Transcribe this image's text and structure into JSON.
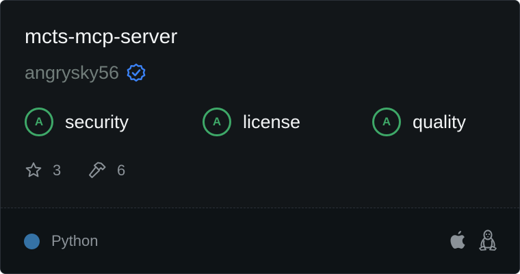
{
  "repo": {
    "name": "mcts-mcp-server",
    "author": "angrysky56",
    "verified": true
  },
  "grades": [
    {
      "letter": "A",
      "label": "security"
    },
    {
      "letter": "A",
      "label": "license"
    },
    {
      "letter": "A",
      "label": "quality"
    }
  ],
  "stats": {
    "stars": "3",
    "tools": "6"
  },
  "footer": {
    "language": "Python",
    "language_color": "#3572A5",
    "platforms": [
      "apple-icon",
      "linux-icon"
    ]
  },
  "colors": {
    "card_bg": "#121619",
    "grade_accent": "#3ea868",
    "verified_accent": "#3b82f6"
  }
}
